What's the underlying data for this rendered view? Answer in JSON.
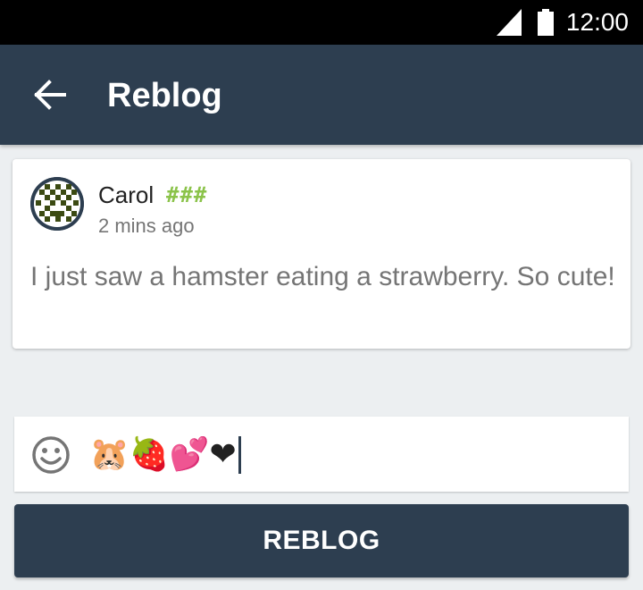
{
  "status_bar": {
    "time": "12:00",
    "icons": [
      "signal-icon",
      "battery-icon"
    ]
  },
  "app_bar": {
    "back_icon": "arrow-left-icon",
    "title": "Reblog"
  },
  "post": {
    "author": "Carol",
    "tag": "###",
    "timestamp": "2 mins ago",
    "text": "I just saw a hamster eating a strawberry. So cute!",
    "avatar_icon": "pixel-avatar-icon"
  },
  "comment_input": {
    "emoji_icon": "smiley-icon",
    "value": "🐹🍓💕❤"
  },
  "reblog_button": {
    "label": "REBLOG"
  },
  "colors": {
    "primary": "#2d3e50",
    "background": "#eceff1",
    "tag": "#8bc34a",
    "secondary_text": "#757575"
  }
}
